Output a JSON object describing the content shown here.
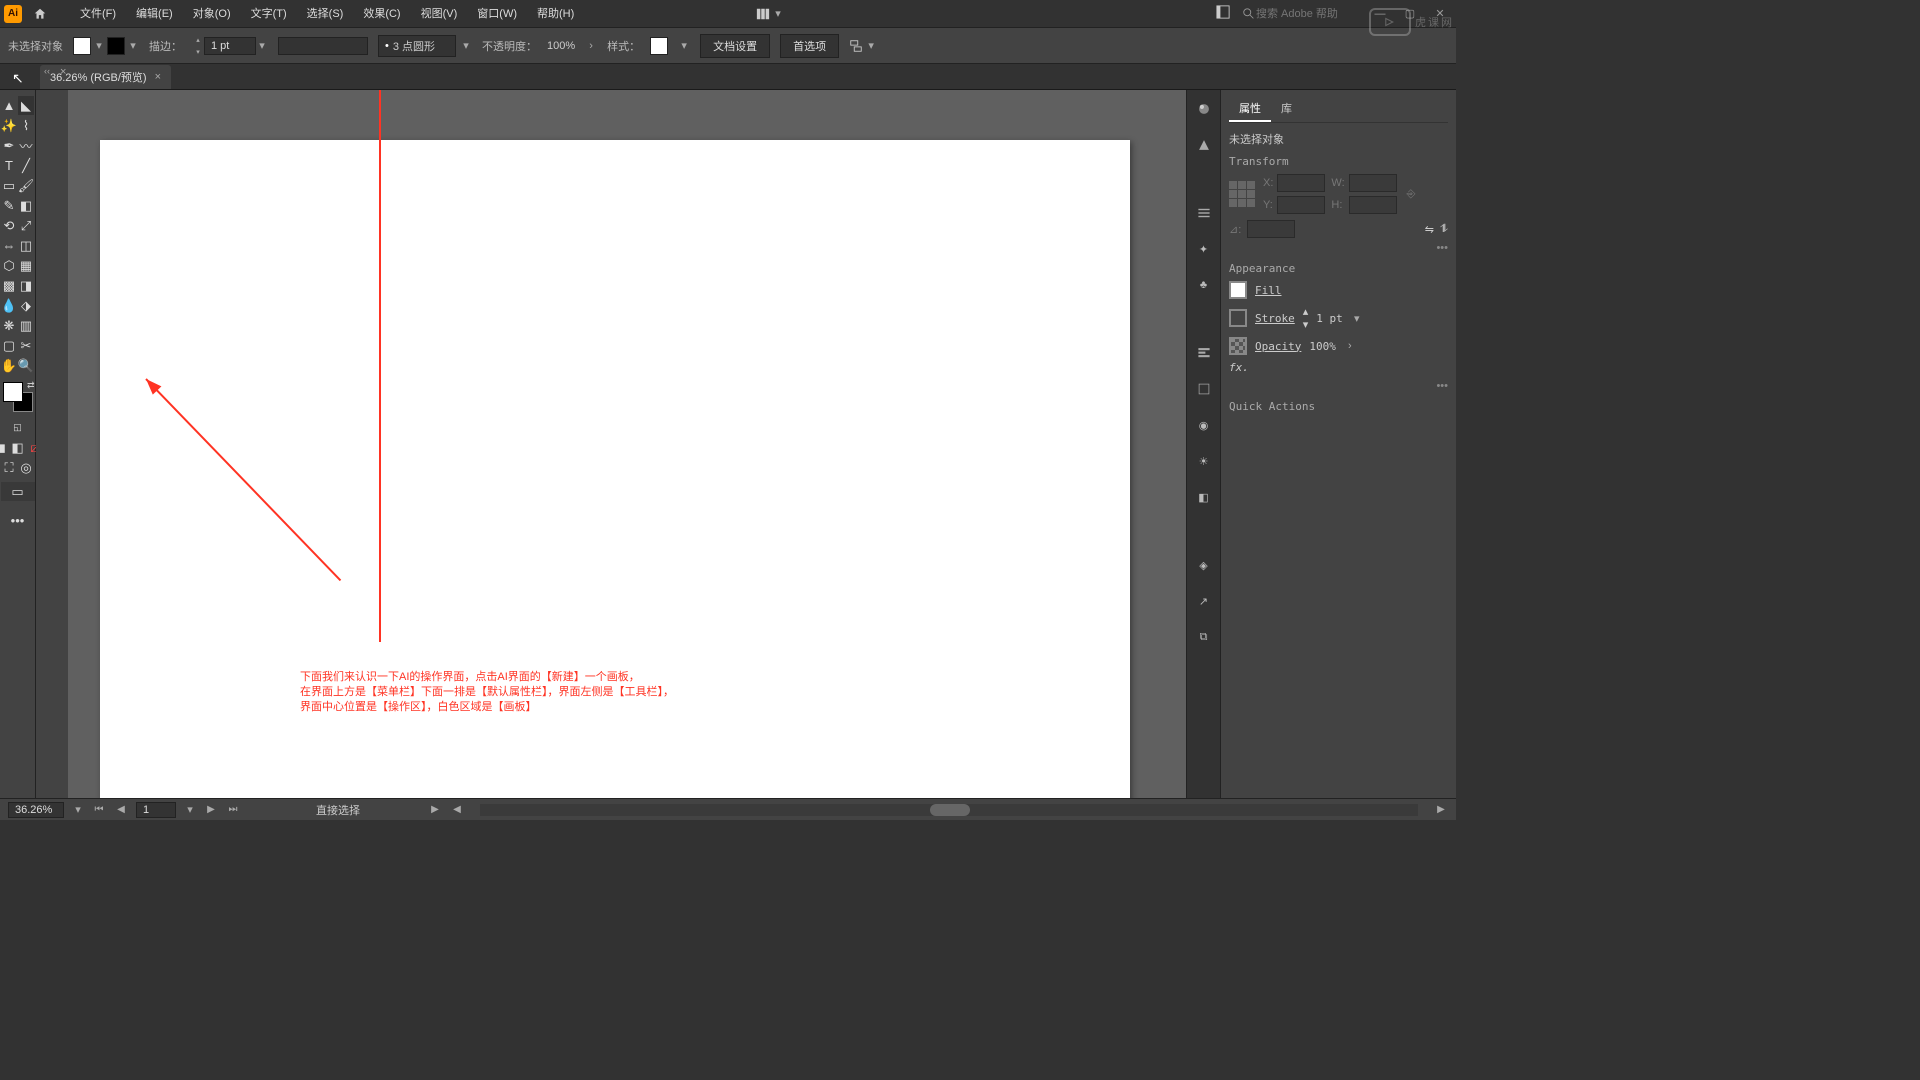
{
  "app": {
    "logo": "Ai"
  },
  "menubar": {
    "items": [
      "文件(F)",
      "编辑(E)",
      "对象(O)",
      "文字(T)",
      "选择(S)",
      "效果(C)",
      "视图(V)",
      "窗口(W)",
      "帮助(H)"
    ],
    "search_placeholder": "搜索 Adobe 帮助"
  },
  "optbar": {
    "no_selection": "未选择对象",
    "stroke_label": "描边：",
    "stroke_value": "1 pt",
    "dash_value": "3 点圆形",
    "opacity_label": "不透明度：",
    "opacity_value": "100%",
    "style_label": "样式：",
    "doc_setup": "文档设置",
    "preferences": "首选项"
  },
  "tabs": {
    "doc_title": "36.26% (RGB/预览)",
    "close": "×",
    "mini_close": "×"
  },
  "annotation": {
    "line1": "下面我们来认识一下AI的操作界面，点击AI界面的【新建】一个画板，",
    "line2": "在界面上方是【菜单栏】下面一排是【默认属性栏】，界面左侧是【工具栏】，",
    "line3": "界面中心位置是【操作区】，白色区域是【画板】"
  },
  "properties": {
    "tab_properties": "属性",
    "tab_library": "库",
    "no_selection": "未选择对象",
    "transform": "Transform",
    "x_label": "X:",
    "y_label": "Y:",
    "w_label": "W:",
    "h_label": "H:",
    "angle_label": "⊿:",
    "appearance": "Appearance",
    "fill": "Fill",
    "stroke": "Stroke",
    "stroke_value": "1 pt",
    "opacity": "Opacity",
    "opacity_value": "100%",
    "fx": "fx.",
    "quick_actions": "Quick Actions"
  },
  "status": {
    "zoom": "36.26%",
    "artboard": "1",
    "tool": "直接选择"
  },
  "watermark": "虎课网"
}
